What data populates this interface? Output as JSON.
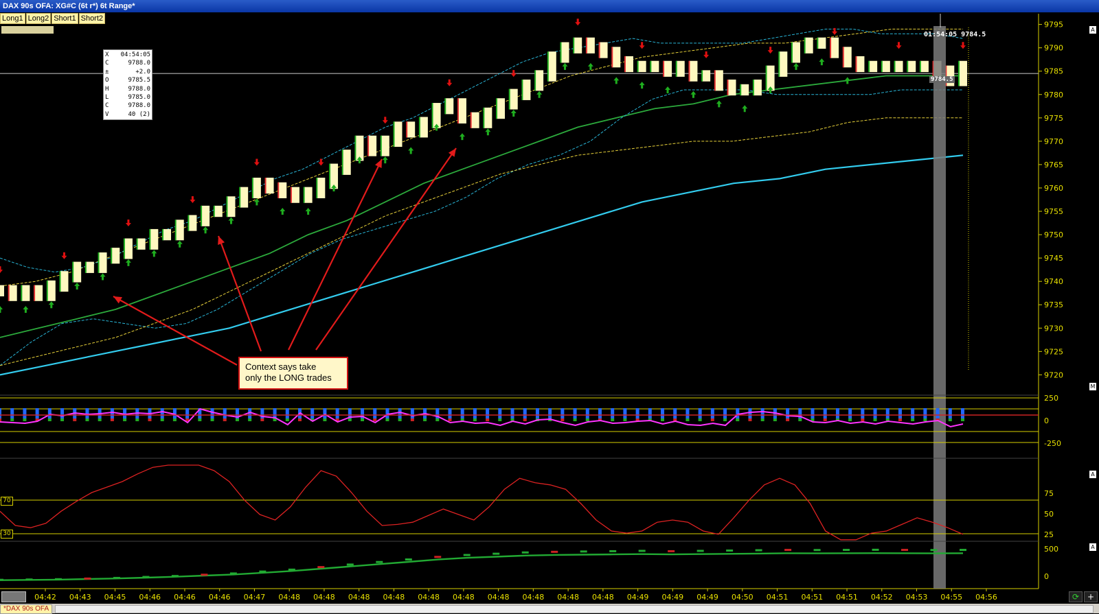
{
  "window_title": "DAX 90s OFA: XG#C (6t r*) 6t Range*",
  "tabs": [
    "Long1",
    "Long2",
    "Short1",
    "Short2"
  ],
  "price_axis": [
    "9795",
    "9790",
    "9785",
    "9780",
    "9775",
    "9770",
    "9765",
    "9760",
    "9755",
    "9750",
    "9745",
    "9740",
    "9735",
    "9730",
    "9725",
    "9720"
  ],
  "time_axis": [
    "04:42",
    "04:43",
    "04:45",
    "04:46",
    "04:46",
    "04:46",
    "04:47",
    "04:48",
    "04:48",
    "04:48",
    "04:48",
    "04:48",
    "04:48",
    "04:48",
    "04:48",
    "04:48",
    "04:48",
    "04:49",
    "04:49",
    "04:49",
    "04:50",
    "04:51",
    "04:51",
    "04:51",
    "04:52",
    "04:53",
    "04:55",
    "04:56"
  ],
  "data_box": [
    {
      "k": "X",
      "v": "04:54:05"
    },
    {
      "k": "C",
      "v": "9788.0"
    },
    {
      "k": "±",
      "v": "+2.0"
    },
    {
      "k": "O",
      "v": "9785.5"
    },
    {
      "k": "H",
      "v": "9788.0"
    },
    {
      "k": "L",
      "v": "9785.0"
    },
    {
      "k": "C",
      "v": "9788.0"
    },
    {
      "k": "V",
      "v": "40 (2)"
    }
  ],
  "cursor_readout": "01:54:05 9784.5",
  "price_marker": "9784.5",
  "annotation": {
    "line1": "Context says take",
    "line2": "only the LONG trades"
  },
  "panels": {
    "delta": {
      "axis": [
        "250",
        "0",
        "-250"
      ]
    },
    "rsi": {
      "axis": [
        "75",
        "50",
        "25"
      ],
      "levels": [
        "70",
        "30"
      ]
    },
    "cum": {
      "axis": [
        "500",
        "0"
      ]
    }
  },
  "panel_markers": [
    "A",
    "M",
    "A",
    "A"
  ],
  "footer_tab": "*DAX 90s OFA",
  "colors": {
    "title_bar": "#0a36a6",
    "tab": "#fff3a8",
    "candle": "#fff8c0",
    "up_arrow": "#1fae1f",
    "down_arrow": "#e01010",
    "band_cyan": "#29b6d8",
    "band_yellow": "#e8d23a",
    "ema_green": "#2caa3c",
    "ema_cyan": "#33ccee",
    "delta_blue": "#2266ff",
    "delta_magenta": "#ff33ff",
    "rsi_red": "#dd2222",
    "cum_green": "#22aa33"
  },
  "chart_data": {
    "type": "candlestick",
    "title": "DAX 90s OFA: XG#C (6t r*) 6t Range*",
    "ylim": [
      9718,
      9797
    ],
    "yticks": [
      9795,
      9790,
      9785,
      9780,
      9775,
      9770,
      9765,
      9760,
      9755,
      9750,
      9745,
      9740,
      9735,
      9730,
      9725,
      9720
    ],
    "closes": [
      9738,
      9737,
      9738,
      9737,
      9739,
      9741,
      9743,
      9743,
      9745,
      9746,
      9748,
      9748,
      9750,
      9750,
      9752,
      9753,
      9755,
      9755,
      9757,
      9759,
      9761,
      9760,
      9759,
      9758,
      9759,
      9761,
      9764,
      9767,
      9770,
      9768,
      9770,
      9773,
      9772,
      9774,
      9777,
      9778,
      9775,
      9774,
      9776,
      9778,
      9780,
      9782,
      9784,
      9788,
      9790,
      9791,
      9790,
      9789,
      9787,
      9786,
      9786,
      9786,
      9785,
      9786,
      9784,
      9784,
      9782,
      9781,
      9781,
      9782,
      9785,
      9788,
      9790,
      9791,
      9791,
      9789,
      9787,
      9786,
      9786,
      9786,
      9786,
      9786,
      9786,
      9785,
      9783,
      9786
    ],
    "bb_upper_cyan": [
      9745,
      9743,
      9742,
      9743,
      9745,
      9748,
      9751,
      9753,
      9756,
      9759,
      9762,
      9764,
      9767,
      9770,
      9773,
      9775,
      9778,
      9781,
      9784,
      9787,
      9789,
      9790,
      9791,
      9792,
      9791,
      9791,
      9791,
      9791,
      9792,
      9793,
      9794,
      9794,
      9793,
      9793,
      9793,
      9792
    ],
    "bb_lower_cyan": [
      9722,
      9727,
      9731,
      9732,
      9731,
      9730,
      9731,
      9734,
      9738,
      9742,
      9746,
      9749,
      9751,
      9753,
      9755,
      9758,
      9762,
      9765,
      9767,
      9770,
      9775,
      9779,
      9781,
      9781,
      9781,
      9780,
      9780,
      9780,
      9780,
      9781,
      9781,
      9781
    ],
    "band_yellow_upper": [
      9739,
      9740,
      9742,
      9745,
      9748,
      9751,
      9754,
      9757,
      9760,
      9763,
      9766,
      9769,
      9772,
      9775,
      9778,
      9781,
      9784,
      9786,
      9788,
      9789,
      9790,
      9791,
      9791,
      9792,
      9793,
      9794,
      9794,
      9794
    ],
    "band_yellow_lower": [
      9722,
      9724,
      9726,
      9728,
      9731,
      9734,
      9738,
      9742,
      9746,
      9750,
      9754,
      9757,
      9760,
      9763,
      9765,
      9767,
      9768,
      9769,
      9770,
      9770,
      9771,
      9772,
      9774,
      9775,
      9775,
      9775
    ],
    "ema_green": [
      9728,
      9730,
      9732,
      9734,
      9737,
      9740,
      9743,
      9746,
      9750,
      9753,
      9757,
      9761,
      9764,
      9767,
      9770,
      9773,
      9775,
      9777,
      9778,
      9780,
      9781,
      9782,
      9783,
      9784,
      9784,
      9784
    ],
    "ema_cyan": [
      9720,
      9722,
      9724,
      9726,
      9728,
      9730,
      9733,
      9736,
      9739,
      9742,
      9745,
      9748,
      9751,
      9754,
      9757,
      9759,
      9761,
      9762,
      9764,
      9765,
      9766,
      9767
    ],
    "up_signals": 34,
    "down_signals": 14,
    "delta": {
      "ylim": [
        -350,
        350
      ],
      "values": [
        -50,
        -60,
        -70,
        -40,
        60,
        40,
        80,
        60,
        70,
        90,
        60,
        80,
        70,
        100,
        60,
        -60,
        140,
        90,
        50,
        20,
        90,
        30,
        10,
        -90,
        80,
        -40,
        60,
        -50,
        20,
        30,
        -60,
        60,
        90,
        40,
        70,
        30,
        -60,
        -40,
        -70,
        -60,
        -100,
        -40,
        -80,
        -20,
        -10,
        -60,
        -100,
        -50,
        -30,
        -70,
        -60,
        -40,
        -30,
        -80,
        -40,
        -90,
        -100,
        -70,
        -100,
        60,
        90,
        100,
        80,
        40,
        30,
        -50,
        -60,
        -30,
        -70,
        -50,
        -80,
        -40,
        -60,
        -80,
        -50,
        -30,
        -120,
        -80
      ]
    },
    "rsi": {
      "ylim": [
        20,
        95
      ],
      "values": [
        48,
        35,
        33,
        37,
        48,
        57,
        65,
        70,
        75,
        82,
        88,
        90,
        90,
        90,
        85,
        75,
        58,
        45,
        40,
        52,
        70,
        85,
        80,
        65,
        48,
        35,
        36,
        38,
        44,
        50,
        45,
        40,
        52,
        68,
        78,
        74,
        72,
        68,
        55,
        40,
        30,
        28,
        30,
        38,
        40,
        38,
        30,
        27,
        42,
        58,
        72,
        78,
        72,
        55,
        30,
        22,
        22,
        28,
        30,
        36,
        42,
        38,
        33,
        27
      ]
    },
    "cum": {
      "ylim": [
        -100,
        600
      ],
      "values": [
        0,
        5,
        10,
        20,
        30,
        45,
        60,
        80,
        100,
        130,
        160,
        200,
        240,
        280,
        320,
        360,
        390,
        410,
        430,
        440,
        445,
        450,
        455,
        450,
        455,
        460,
        465,
        470,
        468,
        470,
        472,
        470,
        468,
        470
      ]
    }
  }
}
